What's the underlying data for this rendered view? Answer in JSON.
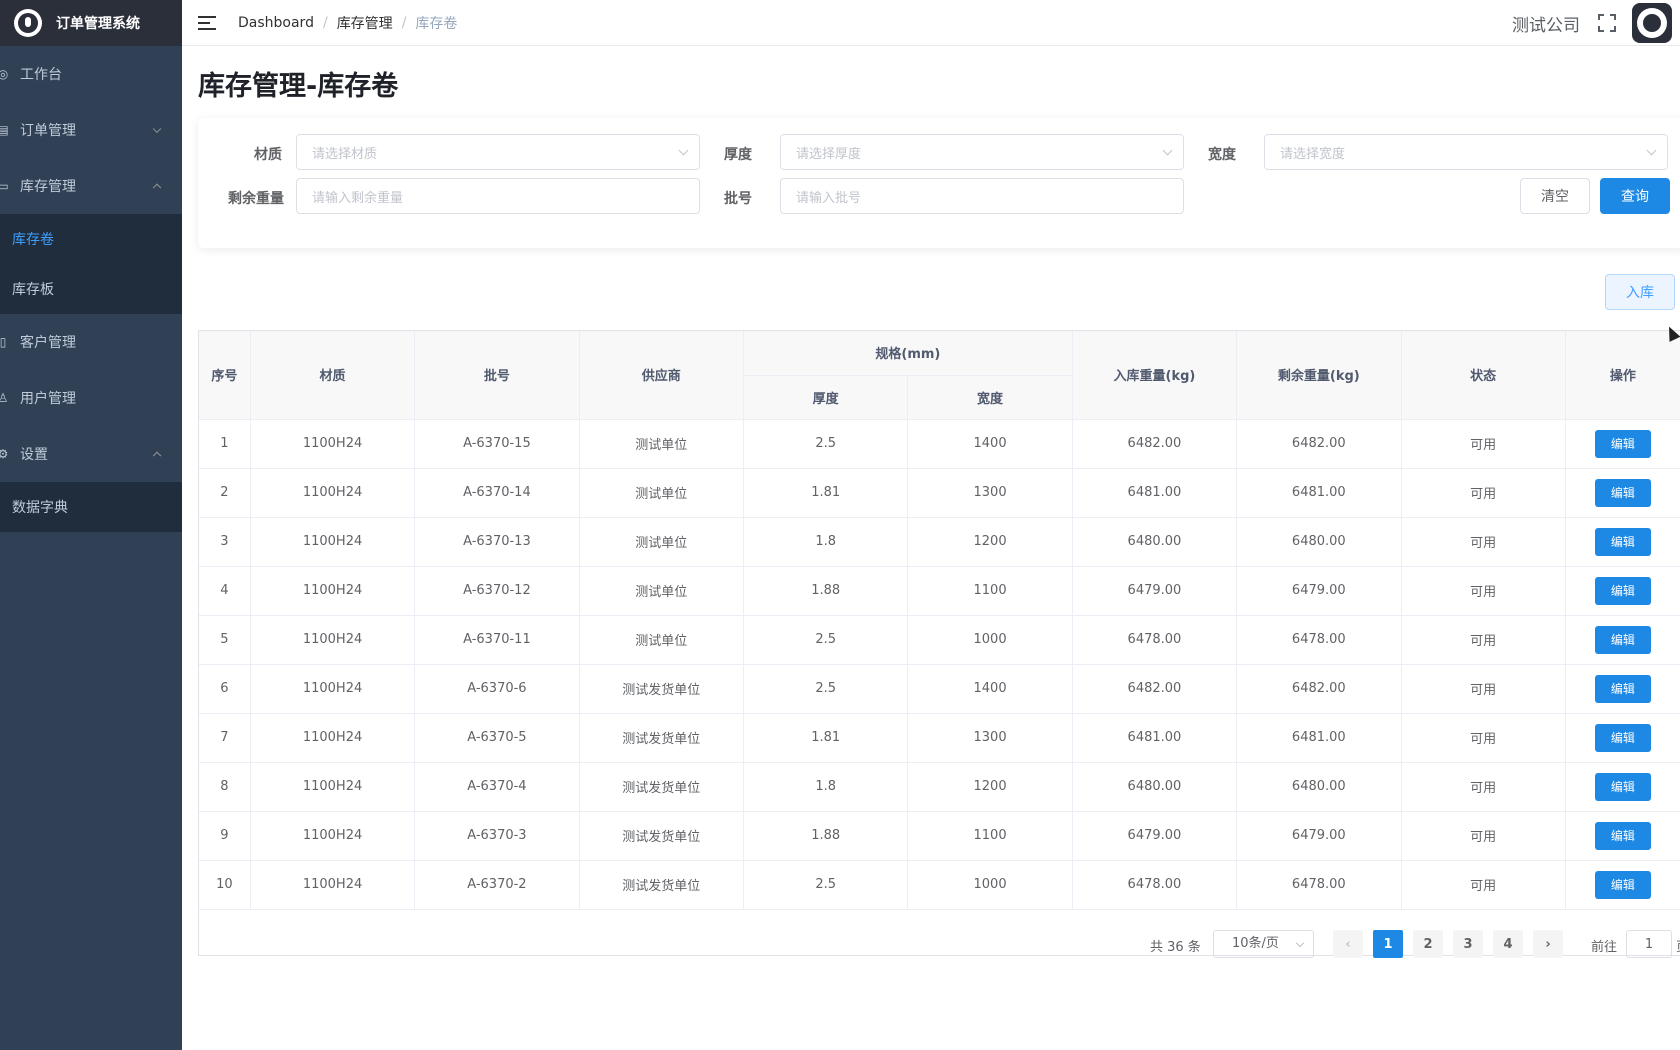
{
  "app": {
    "title": "订单管理系统"
  },
  "sidebar": {
    "items": [
      {
        "label": "工作台"
      },
      {
        "label": "订单管理"
      },
      {
        "label": "库存管理"
      },
      {
        "label": "客户管理"
      },
      {
        "label": "用户管理"
      },
      {
        "label": "设置"
      }
    ],
    "inventory_sub": [
      {
        "label": "库存卷"
      },
      {
        "label": "库存板"
      }
    ],
    "settings_sub": [
      {
        "label": "数据字典"
      }
    ]
  },
  "navbar": {
    "breadcrumb": [
      "Dashboard",
      "库存管理",
      "库存卷"
    ],
    "company": "测试公司"
  },
  "page": {
    "title": "库存管理-库存卷"
  },
  "filters": {
    "material": {
      "label": "材质",
      "placeholder": "请选择材质"
    },
    "thickness": {
      "label": "厚度",
      "placeholder": "请选择厚度"
    },
    "width": {
      "label": "宽度",
      "placeholder": "请选择宽度"
    },
    "remaining": {
      "label": "剩余重量",
      "placeholder": "请输入剩余重量"
    },
    "batch": {
      "label": "批号",
      "placeholder": "请输入批号"
    },
    "clear_label": "清空",
    "search_label": "查询"
  },
  "actions": {
    "stock_in_label": "入库"
  },
  "table": {
    "headers": {
      "index": "序号",
      "material": "材质",
      "batch": "批号",
      "supplier": "供应商",
      "spec": "规格(mm)",
      "thickness": "厚度",
      "width": "宽度",
      "in_weight": "入库重量(kg)",
      "remaining_weight": "剩余重量(kg)",
      "status": "状态",
      "action": "操作"
    },
    "edit_label": "编辑",
    "rows": [
      {
        "index": "1",
        "material": "1100H24",
        "batch": "A-6370-15",
        "supplier": "测试单位",
        "thickness": "2.5",
        "width": "1400",
        "in_weight": "6482.00",
        "remaining_weight": "6482.00",
        "status": "可用"
      },
      {
        "index": "2",
        "material": "1100H24",
        "batch": "A-6370-14",
        "supplier": "测试单位",
        "thickness": "1.81",
        "width": "1300",
        "in_weight": "6481.00",
        "remaining_weight": "6481.00",
        "status": "可用"
      },
      {
        "index": "3",
        "material": "1100H24",
        "batch": "A-6370-13",
        "supplier": "测试单位",
        "thickness": "1.8",
        "width": "1200",
        "in_weight": "6480.00",
        "remaining_weight": "6480.00",
        "status": "可用"
      },
      {
        "index": "4",
        "material": "1100H24",
        "batch": "A-6370-12",
        "supplier": "测试单位",
        "thickness": "1.88",
        "width": "1100",
        "in_weight": "6479.00",
        "remaining_weight": "6479.00",
        "status": "可用"
      },
      {
        "index": "5",
        "material": "1100H24",
        "batch": "A-6370-11",
        "supplier": "测试单位",
        "thickness": "2.5",
        "width": "1000",
        "in_weight": "6478.00",
        "remaining_weight": "6478.00",
        "status": "可用"
      },
      {
        "index": "6",
        "material": "1100H24",
        "batch": "A-6370-6",
        "supplier": "测试发货单位",
        "thickness": "2.5",
        "width": "1400",
        "in_weight": "6482.00",
        "remaining_weight": "6482.00",
        "status": "可用"
      },
      {
        "index": "7",
        "material": "1100H24",
        "batch": "A-6370-5",
        "supplier": "测试发货单位",
        "thickness": "1.81",
        "width": "1300",
        "in_weight": "6481.00",
        "remaining_weight": "6481.00",
        "status": "可用"
      },
      {
        "index": "8",
        "material": "1100H24",
        "batch": "A-6370-4",
        "supplier": "测试发货单位",
        "thickness": "1.8",
        "width": "1200",
        "in_weight": "6480.00",
        "remaining_weight": "6480.00",
        "status": "可用"
      },
      {
        "index": "9",
        "material": "1100H24",
        "batch": "A-6370-3",
        "supplier": "测试发货单位",
        "thickness": "1.88",
        "width": "1100",
        "in_weight": "6479.00",
        "remaining_weight": "6479.00",
        "status": "可用"
      },
      {
        "index": "10",
        "material": "1100H24",
        "batch": "A-6370-2",
        "supplier": "测试发货单位",
        "thickness": "2.5",
        "width": "1000",
        "in_weight": "6478.00",
        "remaining_weight": "6478.00",
        "status": "可用"
      }
    ]
  },
  "pagination": {
    "total": "共 36 条",
    "page_size": "10条/页",
    "pages": [
      "1",
      "2",
      "3",
      "4"
    ],
    "current": "1",
    "goto_label": "前往",
    "goto_value": "1",
    "goto_suffix": "页"
  }
}
